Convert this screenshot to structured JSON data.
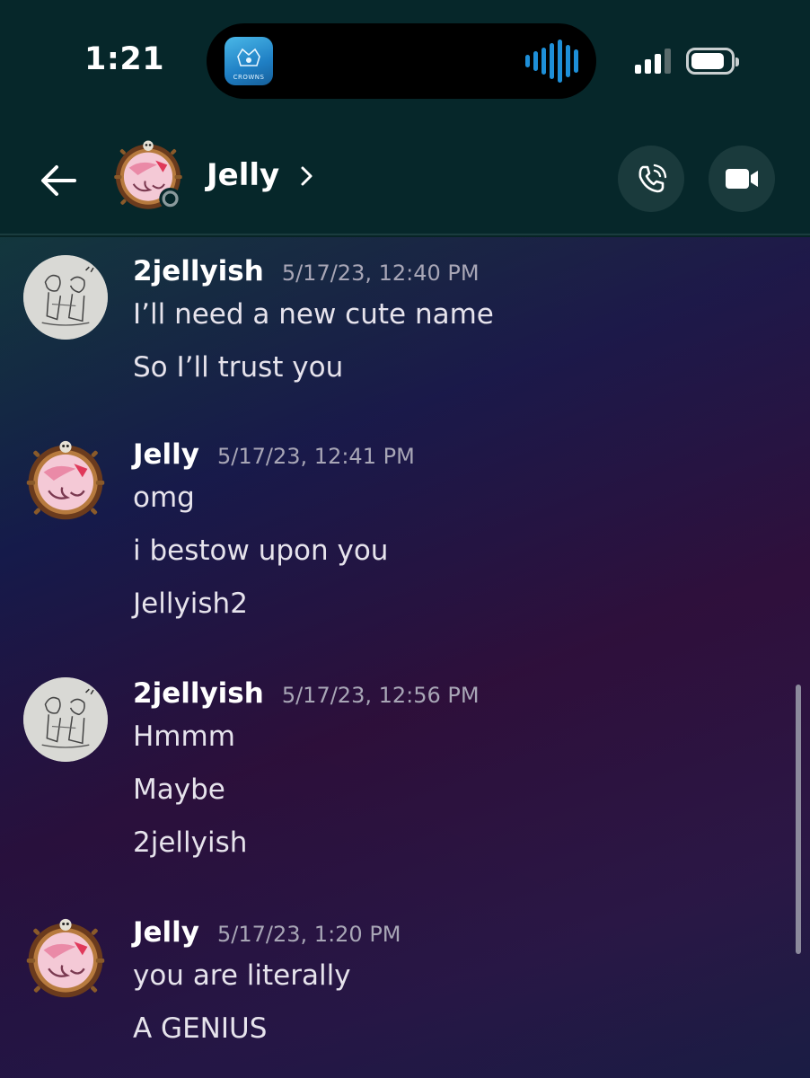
{
  "status_bar": {
    "time": "1:21",
    "live_activity_app_label": "CROWNS"
  },
  "header": {
    "title": "Jelly"
  },
  "messages": [
    {
      "author": "2jellyish",
      "timestamp": "5/17/23, 12:40 PM",
      "lines": [
        "I’ll need a new cute name",
        "So I’ll trust you"
      ]
    },
    {
      "author": "Jelly",
      "timestamp": "5/17/23, 12:41 PM",
      "lines": [
        "omg",
        "i bestow upon you",
        "Jellyish2"
      ]
    },
    {
      "author": "2jellyish",
      "timestamp": "5/17/23, 12:56 PM",
      "lines": [
        "Hmmm",
        "Maybe",
        "2jellyish"
      ]
    },
    {
      "author": "Jelly",
      "timestamp": "5/17/23, 1:20 PM",
      "lines": [
        "you are literally",
        "A GENIUS"
      ]
    }
  ],
  "colors": {
    "header_bg": "#06272a",
    "accent_blue": "#1e8fd8"
  },
  "icons": {
    "back": "arrow-left-icon",
    "call": "phone-icon",
    "video": "video-camera-icon"
  }
}
